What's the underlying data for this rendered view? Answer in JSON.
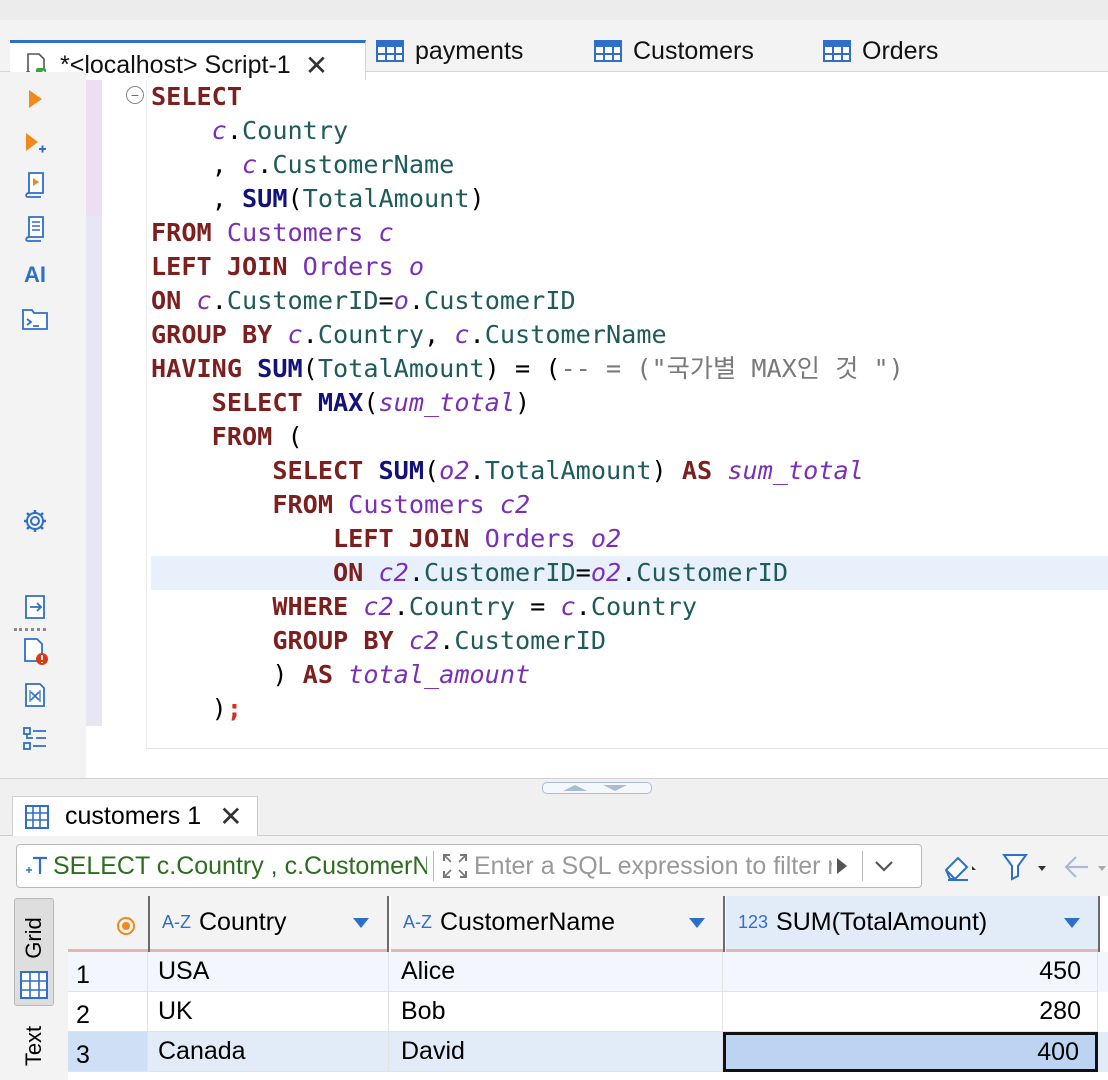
{
  "editor_tabs": [
    {
      "label": "*<localhost> Script-1",
      "icon": "sql-script-icon",
      "active": true
    },
    {
      "label": "payments",
      "icon": "table-icon"
    },
    {
      "label": "Customers",
      "icon": "table-icon"
    },
    {
      "label": "Orders",
      "icon": "table-icon"
    }
  ],
  "left_toolbar": {
    "ai_label": "AI",
    "icons": [
      "execute-statement-icon",
      "execute-new-tab-icon",
      "execute-script-icon",
      "execute-script-new-tab-icon",
      "ai-assistant-icon",
      "open-console-icon",
      "settings-icon",
      "export-icon",
      "problems-icon",
      "explain-plan-icon",
      "outline-icon"
    ]
  },
  "code": {
    "lines": [
      [
        [
          "kw",
          "SELECT"
        ]
      ],
      [
        [
          "t",
          "    "
        ],
        [
          "al",
          "c"
        ],
        [
          "t",
          "."
        ],
        [
          "co",
          "Country"
        ]
      ],
      [
        [
          "t",
          "    , "
        ],
        [
          "al",
          "c"
        ],
        [
          "t",
          "."
        ],
        [
          "co",
          "CustomerName"
        ]
      ],
      [
        [
          "t",
          "    , "
        ],
        [
          "fn",
          "SUM"
        ],
        [
          "t",
          "("
        ],
        [
          "co",
          "TotalAmount"
        ],
        [
          "t",
          ")"
        ]
      ],
      [
        [
          "kw",
          "FROM"
        ],
        [
          "t",
          " "
        ],
        [
          "tb",
          "Customers"
        ],
        [
          "t",
          " "
        ],
        [
          "al",
          "c"
        ]
      ],
      [
        [
          "kw",
          "LEFT JOIN"
        ],
        [
          "t",
          " "
        ],
        [
          "tb",
          "Orders"
        ],
        [
          "t",
          " "
        ],
        [
          "al",
          "o"
        ]
      ],
      [
        [
          "kw",
          "ON"
        ],
        [
          "t",
          " "
        ],
        [
          "al",
          "c"
        ],
        [
          "t",
          "."
        ],
        [
          "co",
          "CustomerID"
        ],
        [
          "t",
          "="
        ],
        [
          "al",
          "o"
        ],
        [
          "t",
          "."
        ],
        [
          "co",
          "CustomerID"
        ]
      ],
      [
        [
          "kw",
          "GROUP BY"
        ],
        [
          "t",
          " "
        ],
        [
          "al",
          "c"
        ],
        [
          "t",
          "."
        ],
        [
          "co",
          "Country"
        ],
        [
          "t",
          ", "
        ],
        [
          "al",
          "c"
        ],
        [
          "t",
          "."
        ],
        [
          "co",
          "CustomerName"
        ]
      ],
      [
        [
          "kw",
          "HAVING"
        ],
        [
          "t",
          " "
        ],
        [
          "fn",
          "SUM"
        ],
        [
          "t",
          "("
        ],
        [
          "co",
          "TotalAmount"
        ],
        [
          "t",
          ") = ("
        ],
        [
          "cm",
          "-- = (\"국가별 MAX인 것 \")"
        ]
      ],
      [
        [
          "t",
          "    "
        ],
        [
          "kw",
          "SELECT"
        ],
        [
          "t",
          " "
        ],
        [
          "fn",
          "MAX"
        ],
        [
          "t",
          "("
        ],
        [
          "al",
          "sum_total"
        ],
        [
          "t",
          ")"
        ]
      ],
      [
        [
          "t",
          "    "
        ],
        [
          "kw",
          "FROM"
        ],
        [
          "t",
          " ("
        ]
      ],
      [
        [
          "t",
          "        "
        ],
        [
          "kw",
          "SELECT"
        ],
        [
          "t",
          " "
        ],
        [
          "fn",
          "SUM"
        ],
        [
          "t",
          "("
        ],
        [
          "al",
          "o2"
        ],
        [
          "t",
          "."
        ],
        [
          "co",
          "TotalAmount"
        ],
        [
          "t",
          ") "
        ],
        [
          "kw",
          "AS"
        ],
        [
          "t",
          " "
        ],
        [
          "al",
          "sum_total"
        ]
      ],
      [
        [
          "t",
          "        "
        ],
        [
          "kw",
          "FROM"
        ],
        [
          "t",
          " "
        ],
        [
          "tb",
          "Customers"
        ],
        [
          "t",
          " "
        ],
        [
          "al",
          "c2"
        ]
      ],
      [
        [
          "t",
          "            "
        ],
        [
          "kw",
          "LEFT JOIN"
        ],
        [
          "t",
          " "
        ],
        [
          "tb",
          "Orders"
        ],
        [
          "t",
          " "
        ],
        [
          "al",
          "o2"
        ]
      ],
      [
        [
          "t",
          "            "
        ],
        [
          "kw",
          "ON"
        ],
        [
          "t",
          " "
        ],
        [
          "al",
          "c2"
        ],
        [
          "t",
          "."
        ],
        [
          "co",
          "CustomerID"
        ],
        [
          "t",
          "="
        ],
        [
          "al",
          "o2"
        ],
        [
          "t",
          "."
        ],
        [
          "co",
          "CustomerID"
        ]
      ],
      [
        [
          "t",
          "        "
        ],
        [
          "kw",
          "WHERE"
        ],
        [
          "t",
          " "
        ],
        [
          "al",
          "c2"
        ],
        [
          "t",
          "."
        ],
        [
          "co",
          "Country"
        ],
        [
          "t",
          " = "
        ],
        [
          "al",
          "c"
        ],
        [
          "t",
          "."
        ],
        [
          "co",
          "Country"
        ]
      ],
      [
        [
          "t",
          "        "
        ],
        [
          "kw",
          "GROUP BY"
        ],
        [
          "t",
          " "
        ],
        [
          "al",
          "c2"
        ],
        [
          "t",
          "."
        ],
        [
          "co",
          "CustomerID"
        ]
      ],
      [
        [
          "t",
          "        ) "
        ],
        [
          "kw",
          "AS"
        ],
        [
          "t",
          " "
        ],
        [
          "al",
          "total_amount"
        ]
      ],
      [
        [
          "t",
          "    )"
        ],
        [
          "red",
          ";"
        ]
      ]
    ]
  },
  "results": {
    "tab_label": "customers 1",
    "filter_sql": "SELECT c.Country , c.CustomerName , SUM(TotalAmount)",
    "filter_placeholder": "Enter a SQL expression to filter results",
    "view_tabs": {
      "grid": "Grid",
      "text": "Text"
    },
    "columns": [
      {
        "type": "A-Z",
        "name": "Country"
      },
      {
        "type": "A-Z",
        "name": "CustomerName"
      },
      {
        "type": "123",
        "name": "SUM(TotalAmount)"
      }
    ],
    "rows": [
      {
        "num": "1",
        "country": "USA",
        "name": "Alice",
        "sum": "450"
      },
      {
        "num": "2",
        "country": "UK",
        "name": "Bob",
        "sum": "280"
      },
      {
        "num": "3",
        "country": "Canada",
        "name": "David",
        "sum": "400"
      }
    ],
    "selected_row": 3
  },
  "colors": {
    "accent": "#2f6fc9",
    "keyword": "#7b1f1f",
    "function": "#12127a",
    "alias": "#7a2fb8",
    "column": "#1f5b5b"
  }
}
